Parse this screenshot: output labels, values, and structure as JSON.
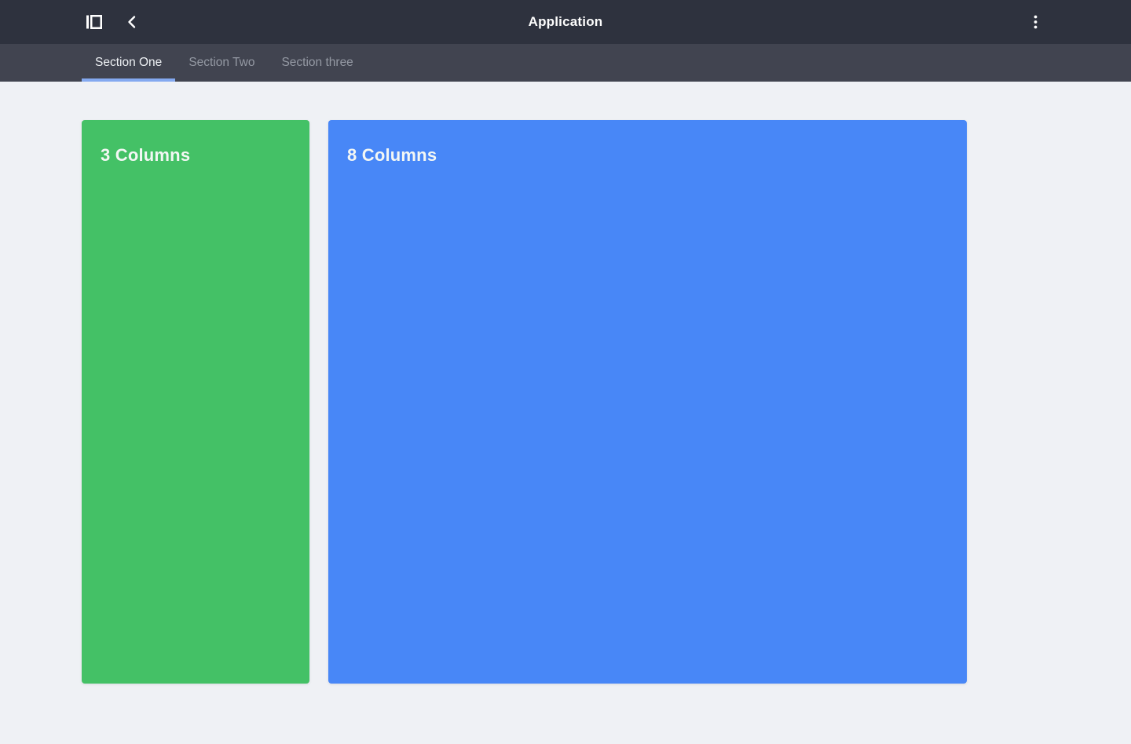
{
  "app_bar": {
    "title": "Application"
  },
  "tabs": [
    {
      "label": "Section One",
      "active": true
    },
    {
      "label": "Section Two",
      "active": false
    },
    {
      "label": "Section three",
      "active": false
    }
  ],
  "cards": [
    {
      "title": "3 Columns",
      "color": "#44c166",
      "span": 3
    },
    {
      "title": "8 Columns",
      "color": "#4887f7",
      "span": 8
    }
  ],
  "colors": {
    "app_bar_bg": "#2e323e",
    "tab_bar_bg": "#414450",
    "tab_underline": "#84a9f0",
    "page_bg": "#eff1f5"
  }
}
